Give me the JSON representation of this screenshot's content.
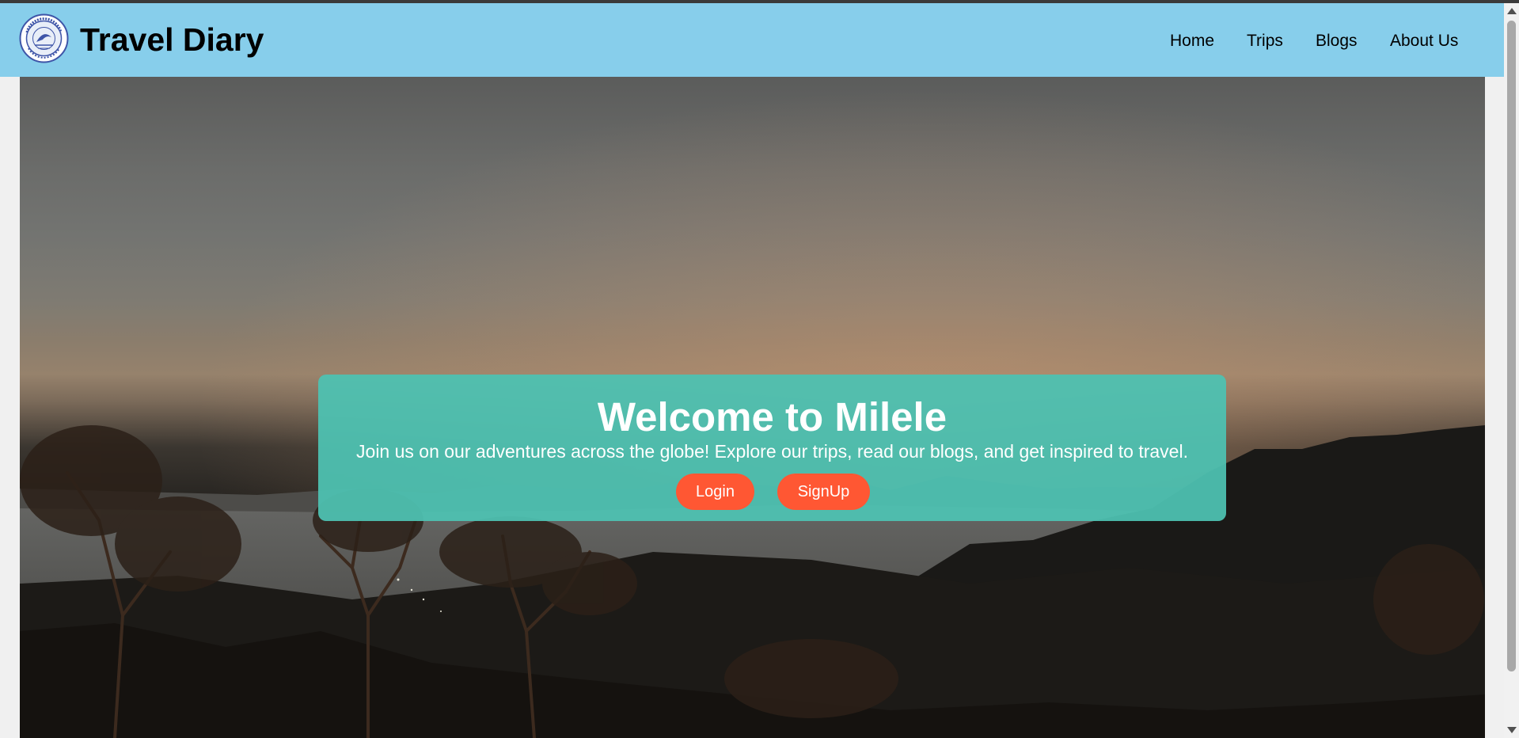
{
  "header": {
    "brand": "Travel Diary",
    "logo_icon": "travel-diary-emblem-icon",
    "logo_text": "TRAVEL DIARIES",
    "nav": [
      {
        "label": "Home"
      },
      {
        "label": "Trips"
      },
      {
        "label": "Blogs"
      },
      {
        "label": "About Us"
      }
    ]
  },
  "hero": {
    "title": "Welcome to Milele",
    "subtitle": "Join us on our adventures across the globe! Explore our trips, read our blogs, and get inspired to travel.",
    "login_label": "Login",
    "signup_label": "SignUp"
  },
  "colors": {
    "navbar": "#87ceeb",
    "card": "#4ec1b1",
    "button": "#ff5733"
  }
}
